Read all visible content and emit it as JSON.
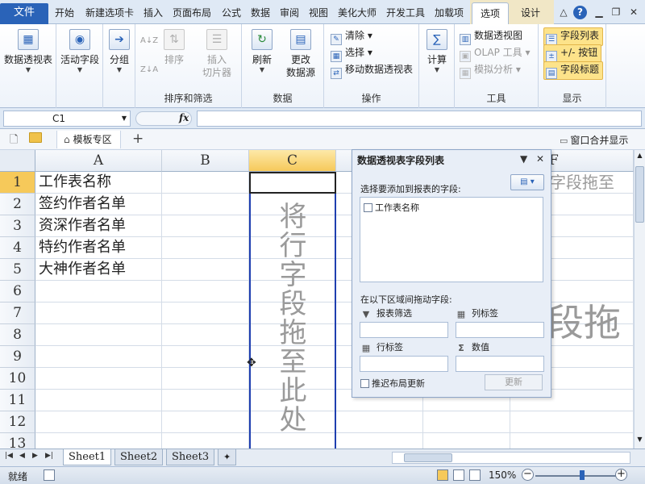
{
  "ribbon_tabs": {
    "file": "文件",
    "items": [
      "开始",
      "新建选项卡",
      "插入",
      "页面布局",
      "公式",
      "数据",
      "审阅",
      "视图",
      "美化大师",
      "开发工具",
      "加载项"
    ],
    "active": "选项",
    "design": "设计"
  },
  "ribbon": {
    "pivot_table": "数据透视表",
    "active_field": "活动字段",
    "group": "分组",
    "sort_az": "A↓Z",
    "sort_za": "Z↓A",
    "sort": "排序",
    "insert_slicer_1": "插入",
    "insert_slicer_2": "切片器",
    "group_sort_filter": "排序和筛选",
    "refresh": "刷新",
    "change_source_1": "更改",
    "change_source_2": "数据源",
    "group_data": "数据",
    "clear": "清除",
    "select": "选择",
    "move_pivot": "移动数据透视表",
    "group_actions": "操作",
    "calculate": "计算",
    "pivot_chart": "数据透视图",
    "olap_tools": "OLAP 工具",
    "what_if": "模拟分析",
    "group_tools": "工具",
    "field_list": "字段列表",
    "plus_minus": "+/- 按钮",
    "field_headers": "字段标题",
    "group_show": "显示"
  },
  "formula_bar": {
    "name_box": "C1",
    "fx": "fx",
    "value": ""
  },
  "doc_bar": {
    "template_zone": "模板专区",
    "add": "+",
    "window_merge": "窗口合并显示"
  },
  "grid": {
    "columns": [
      "A",
      "B",
      "C",
      "D",
      "E",
      "F"
    ],
    "rows": [
      "1",
      "2",
      "3",
      "4",
      "5",
      "6",
      "7",
      "8",
      "9",
      "10",
      "11",
      "12",
      "13"
    ],
    "column_a_values": [
      "工作表名称",
      "签约作者名单",
      "资深作者名单",
      "特约作者名单",
      "大神作者名单"
    ],
    "drop_rows_hint": "将行字段拖至此处",
    "drop_cols_hint": "将列字段拖至此处",
    "drop_values_hint": "将值字段拖至此处",
    "drop_cols_visible": "字段拖至",
    "drop_values_visible": "段拖"
  },
  "field_pane": {
    "title": "数据透视表字段列表",
    "choose_fields": "选择要添加到报表的字段:",
    "fields": [
      "工作表名称"
    ],
    "drag_hint": "在以下区域间拖动字段:",
    "report_filter": "报表筛选",
    "column_labels": "列标签",
    "row_labels": "行标签",
    "values": "数值",
    "defer_update": "推迟布局更新",
    "update": "更新"
  },
  "sheets": [
    "Sheet1",
    "Sheet2",
    "Sheet3"
  ],
  "active_sheet": "Sheet1",
  "status": {
    "ready": "就绪",
    "zoom": "150%"
  },
  "colors": {
    "accent": "#2a63b8",
    "selected_header": "#f6c95a",
    "drop_zone_border": "#1f3fb0"
  }
}
